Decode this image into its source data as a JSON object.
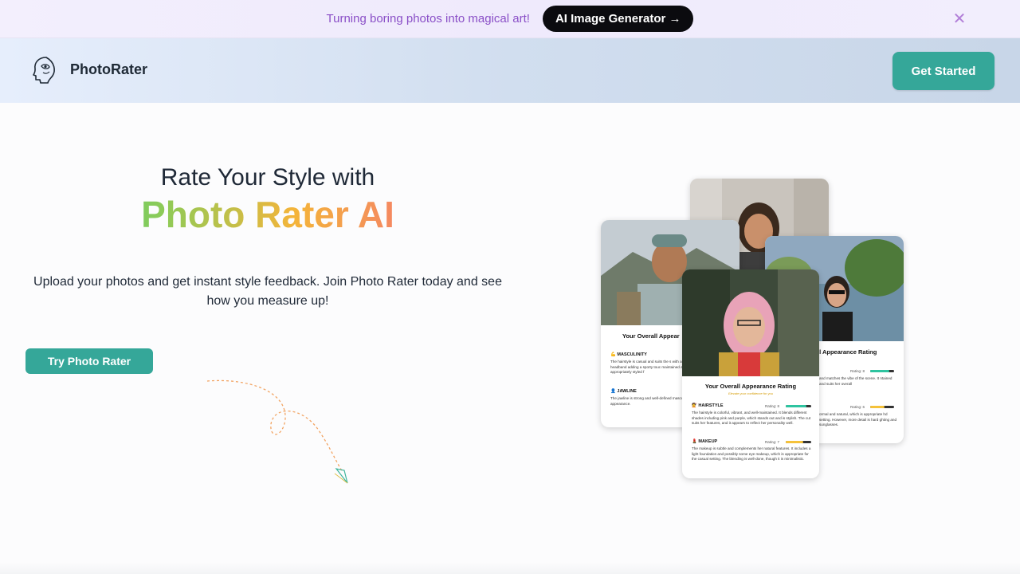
{
  "banner": {
    "text": "Turning boring photos into magical art!",
    "button_label": "AI Image Generator →",
    "close_glyph": "✕"
  },
  "nav": {
    "brand": "PhotoRater",
    "cta_label": "Get Started"
  },
  "hero": {
    "line1": "Rate Your Style with",
    "line2": "Photo Rater AI",
    "subtitle": "Upload your photos and get instant style feedback. Join Photo Rater today and see how you measure up!",
    "button_label": "Try Photo Rater"
  },
  "cards": {
    "left": {
      "title": "Your Overall Appear",
      "sections": [
        {
          "label": "MASCULINITY",
          "icon": "💪",
          "desc": "The hairstyle is casual and suits the s with a headband adding a sporty touc maintained and appropriately styled f"
        },
        {
          "label": "JAWLINE",
          "icon": "👤",
          "desc": "The jawline is strong and well-defined masculine appearance."
        }
      ]
    },
    "right": {
      "title": "ll Appearance Rating",
      "sections": [
        {
          "rating": "Rating: 8",
          "value": 8,
          "color": "#2ec4a0",
          "desc": "and matches the vibe of the scene. It ntained and suits her overall"
        },
        {
          "rating": "Rating: 6",
          "value": 6,
          "color": "#f5c23a",
          "desc": "ormal and natural, which is appropriate hd setting. However, more detail is hard ghting and sunglasses."
        }
      ]
    },
    "front": {
      "title": "Your Overall Appearance Rating",
      "subtitle": "Elevate your confidence for you",
      "sections": [
        {
          "label": "HAIRSTYLE",
          "icon": "💇",
          "rating": "Rating: 8",
          "value": 8,
          "color": "#2ec4a0",
          "desc": "The hairstyle is colorful, vibrant, and well-maintained. It blends different shades including pink and purple, which stands out and is stylish. The cut suits her features, and it appears to reflect her personality well."
        },
        {
          "label": "MAKEUP",
          "icon": "💄",
          "rating": "Rating: 7",
          "value": 7,
          "color": "#f5c23a",
          "desc": "The makeup is subtle and complements her natural features. It includes a light foundation and possibly some eye makeup, which is appropriate for the casual setting. The blending is well-done, though it is minimalistic."
        }
      ]
    }
  },
  "colors": {
    "accent": "#35a799",
    "banner_text": "#8a4fc7"
  }
}
